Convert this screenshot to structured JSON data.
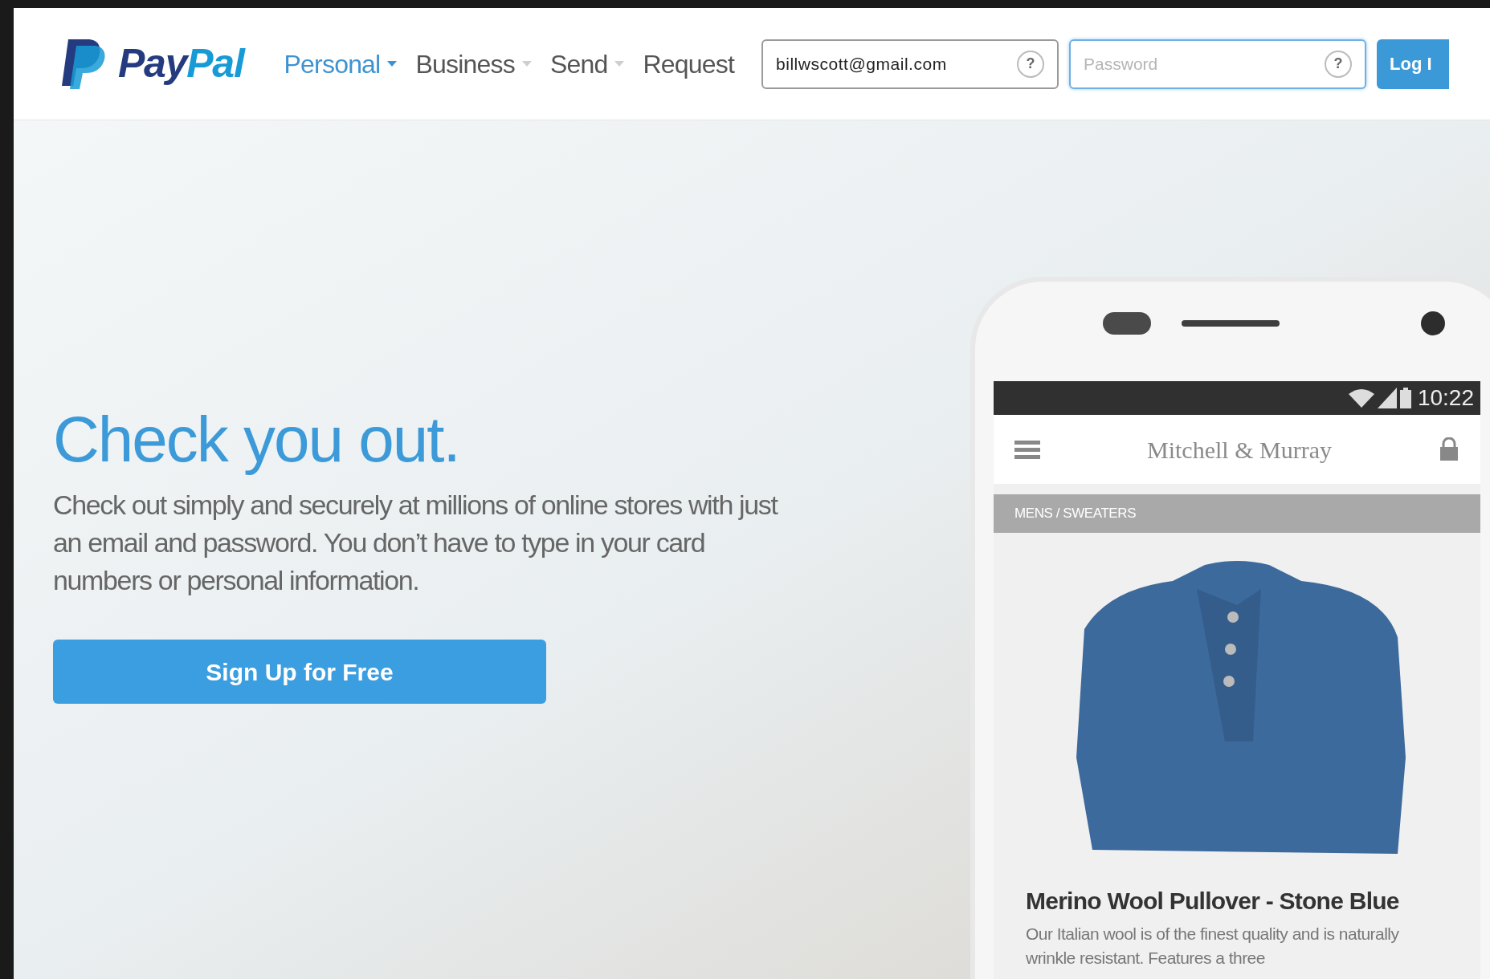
{
  "header": {
    "logo": [
      "Pay",
      "Pal"
    ],
    "nav": [
      {
        "label": "Personal",
        "selected": true,
        "dropdown": true
      },
      {
        "label": "Business",
        "selected": false,
        "dropdown": true
      },
      {
        "label": "Send",
        "selected": false,
        "dropdown": true
      },
      {
        "label": "Request",
        "selected": false,
        "dropdown": false
      }
    ],
    "email_field": {
      "value": "billwscott@gmail.com",
      "help": "?",
      "focused": false
    },
    "password_field": {
      "placeholder": "Password",
      "help": "?",
      "focused": true
    },
    "login_button": "Log I"
  },
  "hero": {
    "headline": "Check you out.",
    "body": "Check out simply and securely at millions of online stores with just an email and password. You don’t have to type in your card numbers or personal information.",
    "cta": "Sign Up for Free"
  },
  "phone": {
    "time": "10:22",
    "store_name": "Mitchell & Murray",
    "breadcrumb": "MENS / SWEATERS",
    "product_title": "Merino Wool Pullover - Stone Blue",
    "product_description": "Our Italian wool is of the finest quality and is naturally wrinkle resistant. Features a three"
  }
}
